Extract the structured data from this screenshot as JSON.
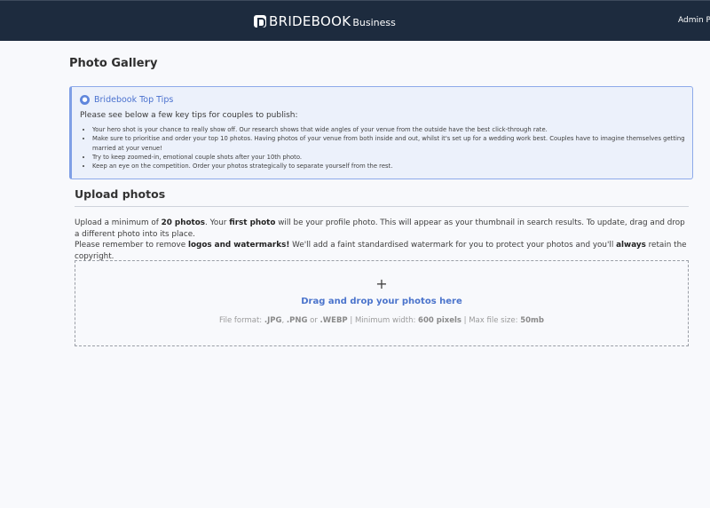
{
  "header": {
    "brand_name": "BRIDEBOOK",
    "brand_sub": "Business",
    "admin_label": "Admin Pa"
  },
  "page": {
    "title": "Photo Gallery"
  },
  "tips": {
    "icon": "bulb-icon",
    "title": "Bridebook Top Tips",
    "intro": "Please see below a few key tips for couples to publish:",
    "items": [
      "Your hero shot is your chance to really show off. Our research shows that wide angles of your venue from the outside have the best click-through rate.",
      "Make sure to prioritise and order your top 10 photos. Having photos of your venue from both inside and out, whilst it's set up for a wedding work best. Couples have to imagine themselves getting married at your venue!",
      "Try to keep zoomed-in, emotional couple shots after your 10th photo.",
      "Keep an eye on the competition. Order your photos strategically to separate yourself from the rest."
    ]
  },
  "upload": {
    "title": "Upload photos",
    "desc1_a": "Upload a minimum of ",
    "desc1_b": "20 photos",
    "desc1_c": ". Your ",
    "desc1_d": "first photo",
    "desc1_e": " will be your profile photo. This will appear as your thumbnail in search results. To update, drag and drop a different photo into its place.",
    "desc2_a": "Please remember to remove ",
    "desc2_b": "logos and watermarks!",
    "desc2_c": " We'll add a faint standardised watermark for you to protect your photos and you'll ",
    "desc2_d": "always",
    "desc2_e": " retain the copyright."
  },
  "dropzone": {
    "plus": "+",
    "label": "Drag and drop your photos here",
    "meta_a": "File format: ",
    "meta_b": ".JPG",
    "meta_c": ", ",
    "meta_d": ".PNG",
    "meta_e": " or ",
    "meta_f": ".WEBP",
    "meta_g": " | Minimum width: ",
    "meta_h": "600 pixels",
    "meta_i": " | Max file size: ",
    "meta_j": "50mb"
  },
  "colors": {
    "topbar": "#1d2b3e",
    "accent": "#4b72cf",
    "tips_bg": "#ecf1fb"
  }
}
